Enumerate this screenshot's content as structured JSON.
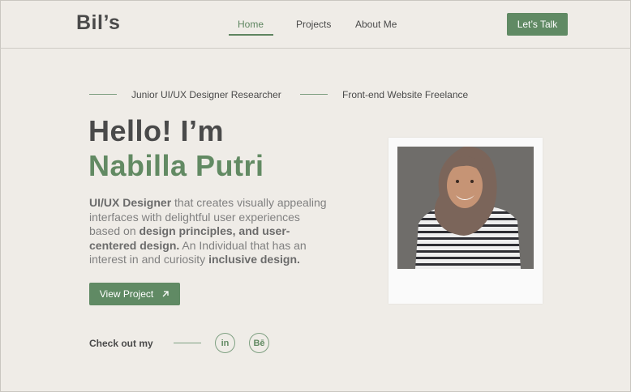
{
  "header": {
    "logo": "Bil’s",
    "nav": {
      "home": "Home",
      "projects": "Projects",
      "about": "About Me"
    },
    "cta": "Let’s Talk"
  },
  "roles": [
    "Junior UI/UX Designer Researcher",
    "Front-end Website Freelance"
  ],
  "hero": {
    "greeting": "Hello! I’m",
    "name": "Nabilla Putri",
    "description": {
      "p1_bold": "UI/UX Designer",
      "p1": " that creates visually appealing interfaces with delightful user experiences based on ",
      "p2_bold": "design principles, and user-centered design.",
      "p3": " An Individual that has an interest in and curiosity ",
      "p4_bold": "inclusive design."
    },
    "button": "View Project"
  },
  "social": {
    "label": "Check out my",
    "linkedin": "in",
    "behance": "Bē"
  },
  "colors": {
    "accent": "#608a64",
    "background": "#efece7",
    "text": "#4a4a4a"
  },
  "icons": [
    "arrow-up-right-icon",
    "linkedin-icon",
    "behance-icon"
  ]
}
